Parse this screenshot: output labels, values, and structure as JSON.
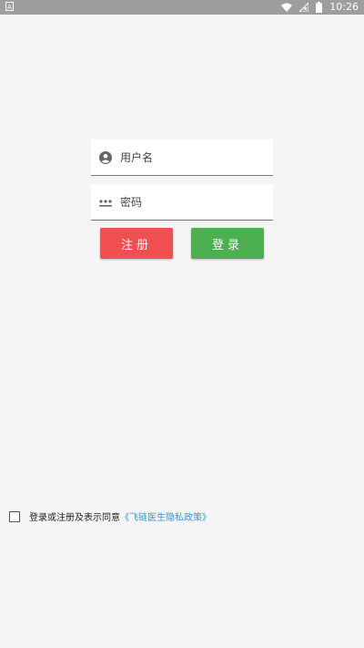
{
  "status_bar": {
    "app_indicator": "A",
    "time": "10:26"
  },
  "login_form": {
    "username_placeholder": "用户名",
    "password_placeholder": "密码",
    "username_value": "",
    "password_value": "",
    "register_label": "注册",
    "login_label": "登录"
  },
  "agreement": {
    "checked": false,
    "text": "登录或注册及表示同意",
    "policy_link": "《飞链医生隐私政策》"
  },
  "colors": {
    "status_bar": "#9e9e9e",
    "register_button": "#f15050",
    "login_button": "#4caf50",
    "link": "#2e9ad6",
    "background": "#f5f5f5"
  },
  "icons": {
    "username_field": "account-circle-icon",
    "password_field": "password-dots-icon"
  }
}
